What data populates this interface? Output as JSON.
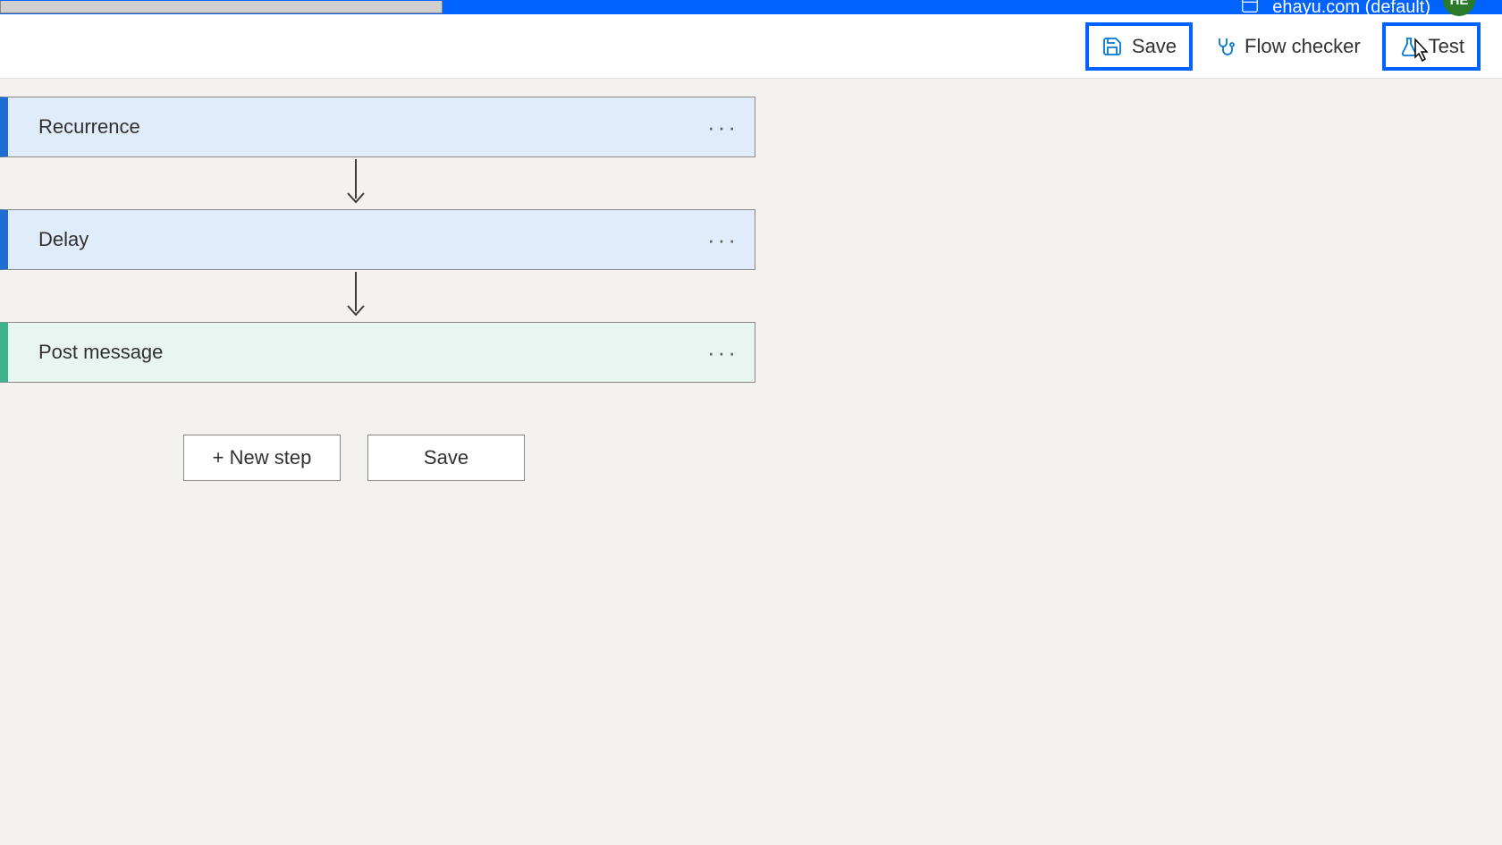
{
  "header": {
    "environment": "ehayu.com (default)",
    "avatar_initials": "HE"
  },
  "toolbar": {
    "save": "Save",
    "flow_checker": "Flow checker",
    "test": "Test"
  },
  "flow": {
    "steps": [
      {
        "title": "Recurrence"
      },
      {
        "title": "Delay"
      },
      {
        "title": "Post message"
      }
    ],
    "new_step": "+ New step",
    "save": "Save"
  }
}
